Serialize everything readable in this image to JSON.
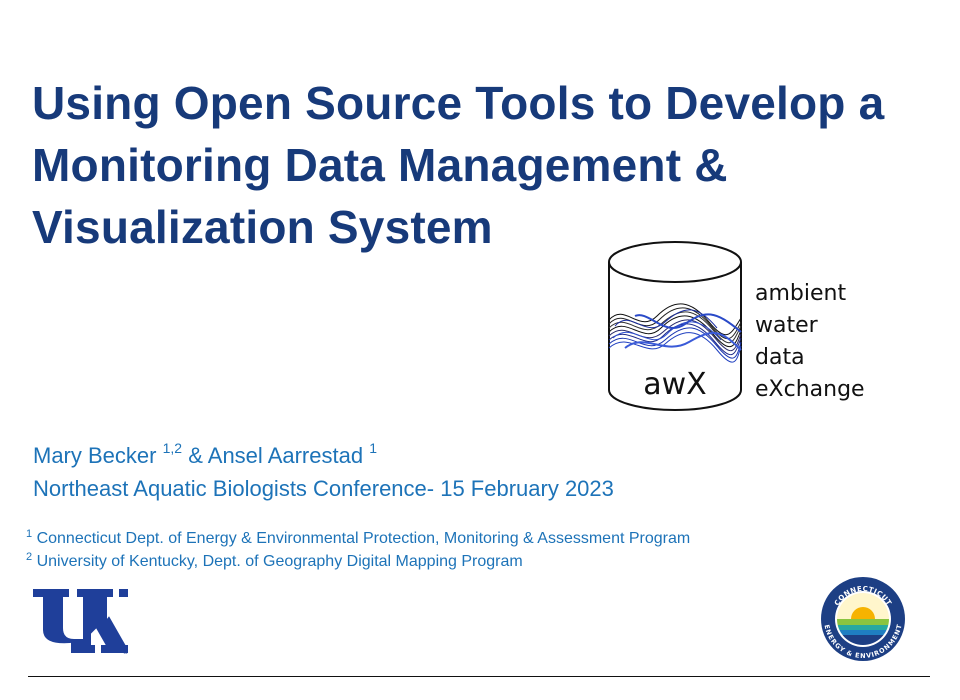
{
  "title": {
    "line1": "Using Open Source Tools to Develop a",
    "line2": "Monitoring Data Management &",
    "line3": "Visualization System"
  },
  "logo_awx": {
    "drum_label": "awX",
    "lines": [
      "ambient",
      "water",
      "data",
      "eXchange"
    ]
  },
  "authors": {
    "author1": "Mary Becker",
    "author1_sup": "1,2",
    "joiner": " & ",
    "author2": "Ansel Aarrestad",
    "author2_sup": "1"
  },
  "conference": "Northeast Aquatic Biologists Conference- 15 February 2023",
  "affiliations": [
    {
      "sup": "1",
      "text": "Connecticut Dept. of Energy & Environmental Protection, Monitoring & Assessment Program"
    },
    {
      "sup": "2",
      "text": "University of Kentucky, Dept. of Geography Digital Mapping Program"
    }
  ],
  "ct_logo": {
    "top_text": "CONNECTICUT",
    "bottom_text": "ENERGY & ENVIRONMENT"
  },
  "colors": {
    "title": "#173a7a",
    "accent": "#1d73b8"
  }
}
